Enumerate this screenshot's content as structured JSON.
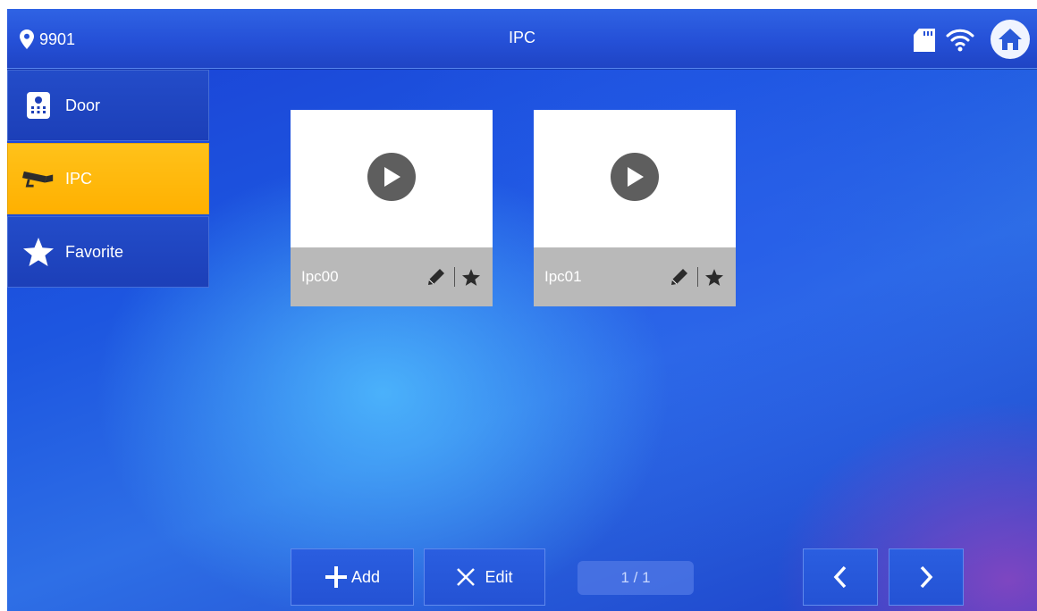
{
  "topbar": {
    "location": "9901",
    "title": "IPC"
  },
  "sidebar": {
    "items": [
      {
        "label": "Door",
        "icon": "door-station-icon",
        "active": false
      },
      {
        "label": "IPC",
        "icon": "camera-icon",
        "active": true
      },
      {
        "label": "Favorite",
        "icon": "star-icon",
        "active": false
      }
    ]
  },
  "cards": [
    {
      "name": "Ipc00"
    },
    {
      "name": "Ipc01"
    }
  ],
  "toolbar": {
    "add_label": "Add",
    "edit_label": "Edit",
    "page": "1 / 1"
  },
  "colors": {
    "accent": "#ffb400",
    "background": "#1f4fd8",
    "card_footer": "#b9b9b9"
  }
}
